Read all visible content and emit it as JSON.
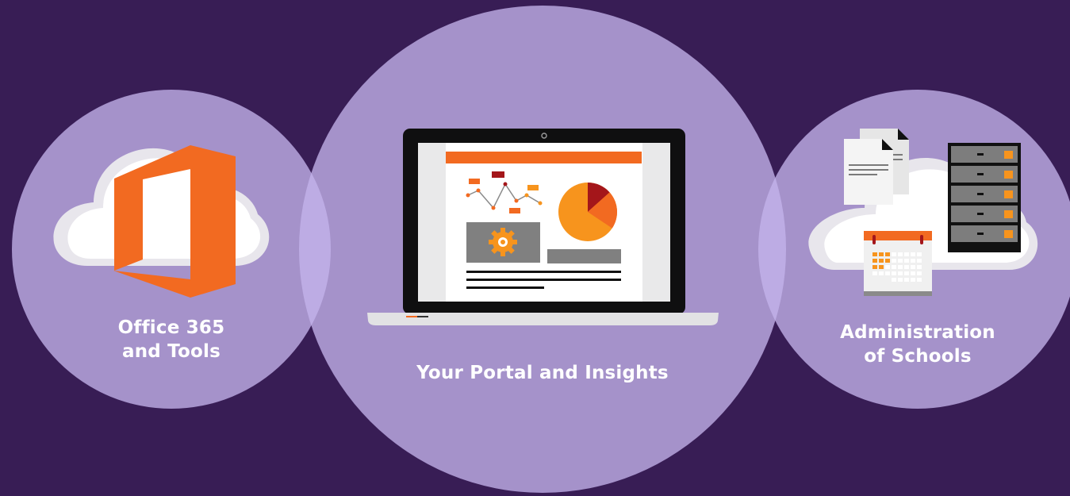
{
  "sections": [
    {
      "id": "office",
      "line1": "Office 365",
      "line2": "and Tools"
    },
    {
      "id": "portal",
      "line1": "Your Portal and Insights"
    },
    {
      "id": "admin",
      "line1": "Administration",
      "line2": "of Schools"
    }
  ],
  "colors": {
    "background": "#381d55",
    "circle": "#b9a7e2",
    "orange": "#f26a21",
    "amber": "#f7941d",
    "dark_red": "#a4161a",
    "gray": "#7d7d7d",
    "cloud": "#ffffff"
  },
  "icons": [
    "cloud-icon",
    "office-logo-icon",
    "laptop-icon",
    "line-chart-icon",
    "pie-chart-icon",
    "gear-icon",
    "document-icon",
    "calendar-icon",
    "server-rack-icon"
  ]
}
